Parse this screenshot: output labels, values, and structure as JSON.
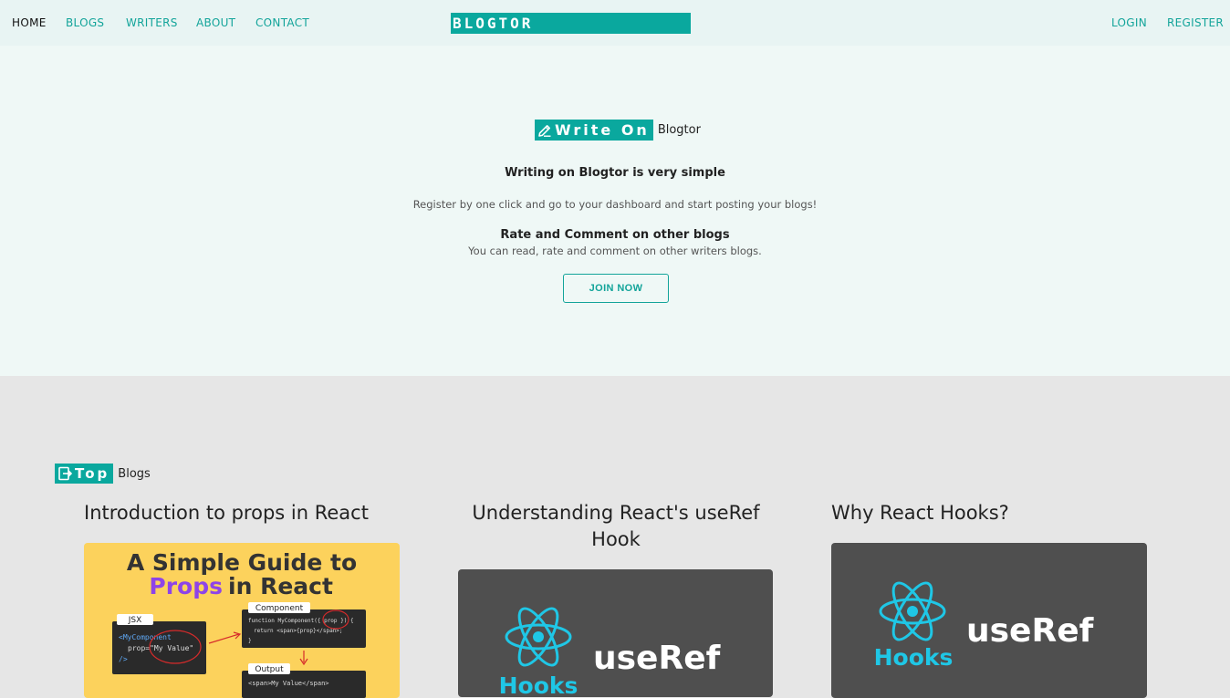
{
  "nav": {
    "links": [
      "HOME",
      "BLOGS",
      "WRITERS",
      "ABOUT",
      "CONTACT"
    ],
    "brand": "BLOGTOR",
    "login": "LOGIN",
    "register": "REGISTER"
  },
  "hero": {
    "badge": "Write On",
    "badge_rest": "Blogtor",
    "title": "Writing on Blogtor is very simple",
    "description": "Register by one click and go to your dashboard and start posting your blogs!",
    "subtitle": "Rate and Comment on other blogs",
    "sub_description": "You can read, rate and comment on other writers blogs.",
    "cta": "JOIN NOW"
  },
  "top_blogs": {
    "badge": "Top",
    "badge_rest": "Blogs",
    "cards": [
      {
        "title": "Introduction to props in React",
        "image": {
          "headline_1": "A Simple Guide to",
          "headline_accent": "Props",
          "headline_2": "in React",
          "label_jsx": "JSX",
          "label_component": "Component",
          "label_output": "Output",
          "code_jsx_1": "<MyComponent",
          "code_jsx_2": "prop=\"My Value\"",
          "code_jsx_3": "/>",
          "code_comp_1": "function MyComponent({ prop }) {",
          "code_comp_2": "return <span>{prop}</span>;",
          "code_comp_3": "}",
          "code_out": "<span>My Value</span>"
        }
      },
      {
        "title": "Understanding React's useRef Hook",
        "image": {
          "hooks": "Hooks",
          "word": "useRef"
        }
      },
      {
        "title": "Why React Hooks?",
        "image": {
          "hooks": "Hooks",
          "word": "useRef"
        }
      }
    ]
  },
  "colors": {
    "accent": "#0aa89e",
    "link": "#13a49a",
    "hero_bg": "#eff8f6",
    "section_bg": "#e6e6e6",
    "react_blue": "#1fc7e6"
  }
}
